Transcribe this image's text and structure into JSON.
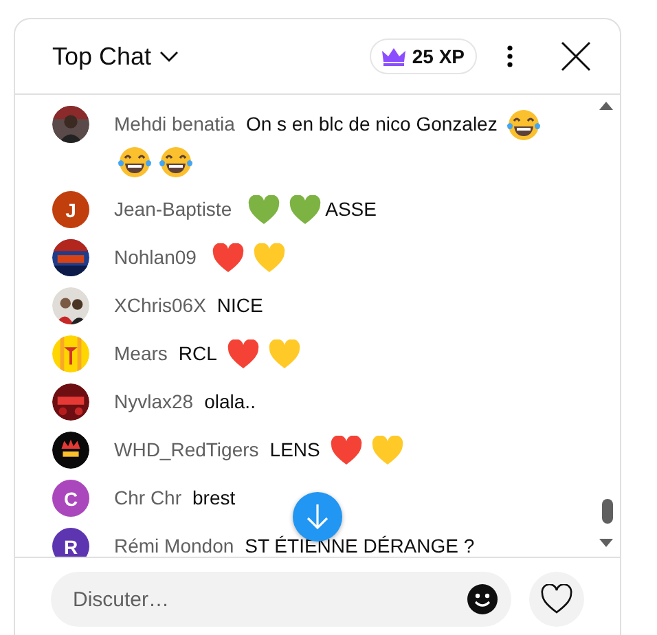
{
  "header": {
    "title": "Top Chat",
    "xp": "25 XP"
  },
  "messages": [
    {
      "author": "Mehdi benatia",
      "avatar": {
        "kind": "picture"
      },
      "parts": [
        {
          "kind": "text",
          "text": "On s en blc de nico Gonzalez"
        },
        {
          "kind": "laugh"
        },
        {
          "kind": "laugh"
        },
        {
          "kind": "laugh"
        }
      ]
    },
    {
      "author": "Jean-Baptiste",
      "avatar": {
        "kind": "letter",
        "letter": "J",
        "color": "#c13e0d"
      },
      "parts": [
        {
          "kind": "heart",
          "color": "#7cb342"
        },
        {
          "kind": "heart",
          "color": "#7cb342"
        },
        {
          "kind": "text",
          "text": "ASSE"
        }
      ]
    },
    {
      "author": "Nohlan09",
      "avatar": {
        "kind": "picture"
      },
      "parts": [
        {
          "kind": "heart",
          "color": "#f44336"
        },
        {
          "kind": "heart",
          "color": "#ffca28"
        }
      ]
    },
    {
      "author": "XChris06X",
      "avatar": {
        "kind": "picture"
      },
      "parts": [
        {
          "kind": "text",
          "text": "NICE"
        }
      ]
    },
    {
      "author": "Mears",
      "avatar": {
        "kind": "picture"
      },
      "parts": [
        {
          "kind": "text",
          "text": "RCL"
        },
        {
          "kind": "heart",
          "color": "#f44336"
        },
        {
          "kind": "heart",
          "color": "#ffca28"
        }
      ]
    },
    {
      "author": "Nyvlax28",
      "avatar": {
        "kind": "picture"
      },
      "parts": [
        {
          "kind": "text",
          "text": "olala.."
        }
      ]
    },
    {
      "author": "WHD_RedTigers",
      "avatar": {
        "kind": "picture"
      },
      "parts": [
        {
          "kind": "text",
          "text": "LENS"
        },
        {
          "kind": "heart",
          "color": "#f44336"
        },
        {
          "kind": "heart",
          "color": "#ffca28"
        }
      ]
    },
    {
      "author": "Chr Chr",
      "avatar": {
        "kind": "letter",
        "letter": "C",
        "color": "#ab47bc"
      },
      "parts": [
        {
          "kind": "text",
          "text": "brest"
        }
      ]
    },
    {
      "author": "Rémi Mondon",
      "avatar": {
        "kind": "letter",
        "letter": "R",
        "color": "#5e35b1"
      },
      "parts": [
        {
          "kind": "text",
          "text": "ST ÉTIENNE DÉRANGE ?"
        }
      ]
    }
  ],
  "composer": {
    "placeholder": "Discuter…"
  }
}
